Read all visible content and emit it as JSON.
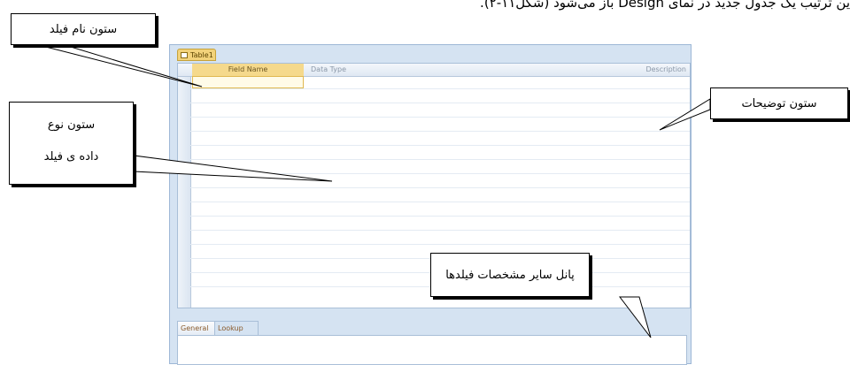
{
  "page": {
    "top_line": "ین ترتیب یک جدول جدید در نمای Design باز می‌شود (شکل۱۱-۲)."
  },
  "window": {
    "tab_title": "Table1",
    "grid_headers": {
      "field_name": "Field Name",
      "data_type": "Data Type",
      "description": "Description"
    },
    "panel_tabs": {
      "general": "General",
      "lookup": "Lookup"
    }
  },
  "callouts": {
    "field_name_column": "ستون نام فیلد",
    "data_type_line1": "ستون نوع",
    "data_type_line2": "داده ی فیلد",
    "description_column": "ستون توضیحات",
    "field_properties_panel": "پانل سایر مشخصات فیلدها"
  },
  "colors": {
    "window_frame": "#d5e3f2",
    "selected_header": "#f5d98c",
    "callout_border": "#000000"
  }
}
